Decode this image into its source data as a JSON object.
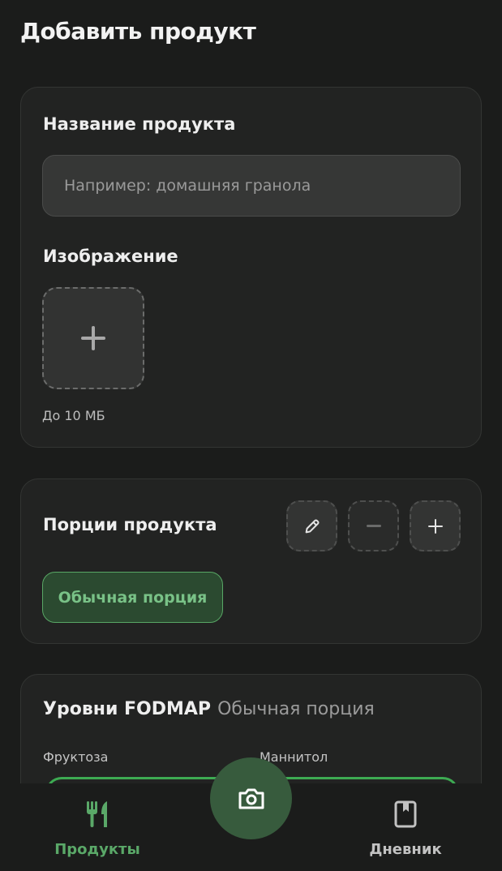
{
  "page": {
    "title": "Добавить продукт"
  },
  "product_name": {
    "label": "Название продукта",
    "placeholder": "Например: домашняя гранола",
    "value": ""
  },
  "image": {
    "label": "Изображение",
    "hint": "До 10 МБ",
    "add_icon": "plus-icon"
  },
  "portions": {
    "label": "Порции продукта",
    "actions": [
      "pencil-icon",
      "minus-icon",
      "plus-icon"
    ],
    "selected_chip": "Обычная порция"
  },
  "fodmap": {
    "title": "Уровни FODMAP",
    "portion": "Обычная порция",
    "nutrients": [
      "Фруктоза",
      "Маннитол"
    ],
    "bar_color": "#3daa52"
  },
  "bottom_nav": {
    "items": [
      {
        "label": "Продукты",
        "icon": "utensils-icon",
        "active": true
      },
      {
        "label": "Дневник",
        "icon": "book-icon",
        "active": false
      }
    ],
    "center_action": "camera-icon"
  },
  "colors": {
    "background": "#1b1c1b",
    "card": "#222322",
    "accent": "#5aa868",
    "camera_button": "#375b3d"
  }
}
